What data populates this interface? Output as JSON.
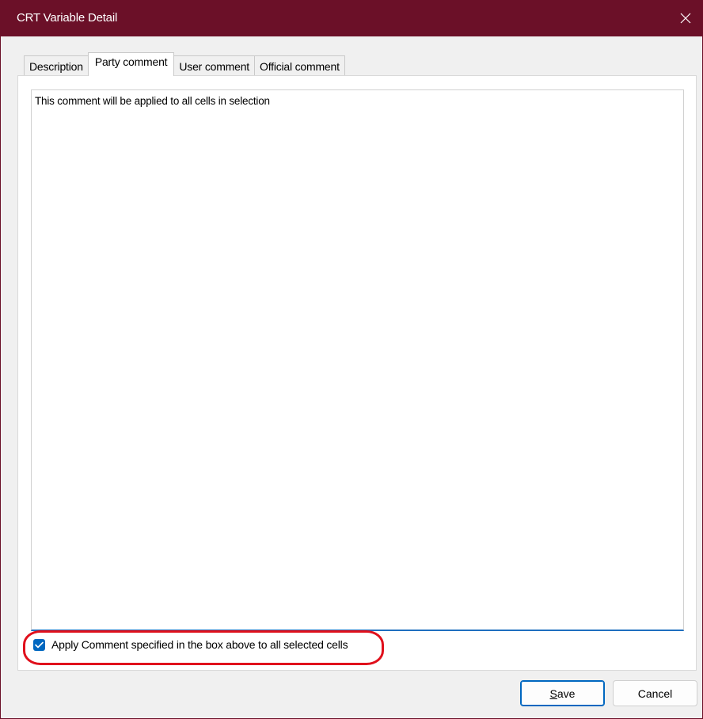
{
  "window": {
    "title": "CRT Variable Detail",
    "titlebar_color": "#6b1028"
  },
  "tabs": [
    {
      "label": "Description",
      "active": false
    },
    {
      "label": "Party comment",
      "active": true
    },
    {
      "label": "User comment",
      "active": false
    },
    {
      "label": "Official comment",
      "active": false
    }
  ],
  "comment": {
    "value": "This comment will be applied to all cells in selection"
  },
  "apply_checkbox": {
    "label": "Apply Comment specified in the box above to all selected cells",
    "checked": true
  },
  "buttons": {
    "save_first": "S",
    "save_rest": "ave",
    "cancel": "Cancel"
  },
  "accent_color": "#0067c0",
  "highlight_color": "#e0101c",
  "icons": {
    "close": "close-icon",
    "check": "checkmark-icon"
  }
}
